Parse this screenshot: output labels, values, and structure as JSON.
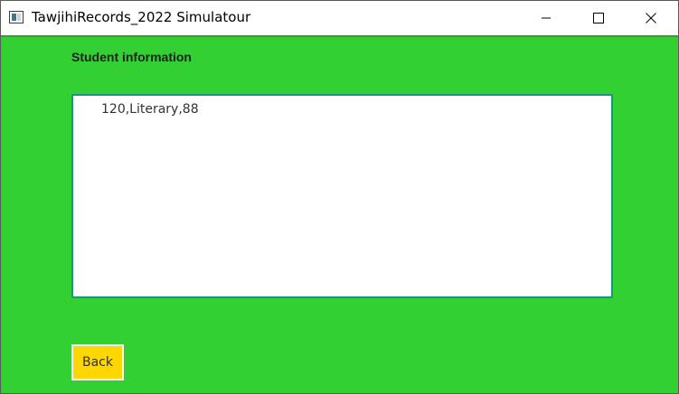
{
  "window": {
    "title": "TawjihiRecords_2022 Simulatour",
    "icons": {
      "app": "application-window-icon",
      "minimize": "minimize-icon",
      "maximize": "maximize-icon",
      "close": "close-icon"
    }
  },
  "main": {
    "heading": "Student information",
    "info_box": {
      "value": "120,Literary,88"
    },
    "back_label": "Back"
  },
  "colors": {
    "background": "#32d032",
    "textbox_border": "#1f8f8a",
    "button": "#ffd700"
  }
}
